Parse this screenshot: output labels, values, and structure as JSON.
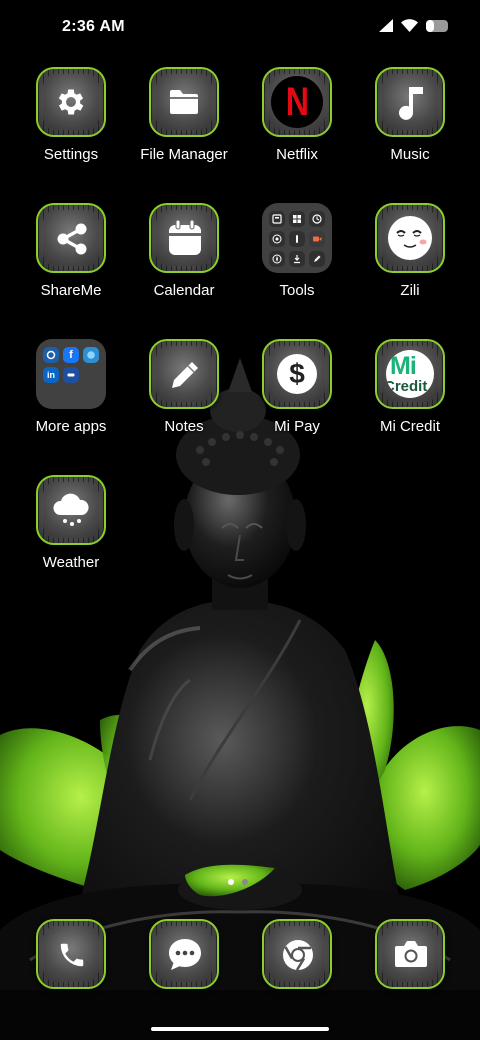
{
  "status_bar": {
    "time": "2:36 AM",
    "icons": [
      "signal-icon",
      "wifi-icon",
      "battery-icon"
    ]
  },
  "apps": {
    "settings": {
      "label": "Settings",
      "icon": "gear-icon"
    },
    "file_manager": {
      "label": "File Manager",
      "icon": "folder-icon"
    },
    "netflix": {
      "label": "Netflix",
      "icon": "netflix-icon",
      "logo_text": "N"
    },
    "music": {
      "label": "Music",
      "icon": "music-note-icon"
    },
    "shareme": {
      "label": "ShareMe",
      "icon": "share-icon"
    },
    "calendar": {
      "label": "Calendar",
      "icon": "calendar-icon"
    },
    "tools": {
      "label": "Tools",
      "icon": "tools-folder-icon"
    },
    "zili": {
      "label": "Zili",
      "icon": "zili-face-icon"
    },
    "more_apps": {
      "label": "More apps",
      "icon": "more-apps-folder-icon"
    },
    "notes": {
      "label": "Notes",
      "icon": "pencil-icon"
    },
    "mi_pay": {
      "label": "Mi Pay",
      "icon": "dollar-icon",
      "logo_text": "$"
    },
    "mi_credit": {
      "label": "Mi Credit",
      "icon": "mi-credit-icon",
      "logo_text": "Mi",
      "logo_subtext": "Credit"
    },
    "weather": {
      "label": "Weather",
      "icon": "snow-cloud-icon"
    }
  },
  "dock": {
    "phone": {
      "icon": "phone-icon"
    },
    "messages": {
      "icon": "message-icon"
    },
    "chrome": {
      "icon": "chrome-icon"
    },
    "camera": {
      "icon": "camera-icon"
    }
  },
  "page_indicator": {
    "pages": 2,
    "current": 1
  },
  "colors": {
    "icon_border": "#8ccf2c",
    "background": "#000000",
    "leaf_green": "#6cc31a"
  }
}
